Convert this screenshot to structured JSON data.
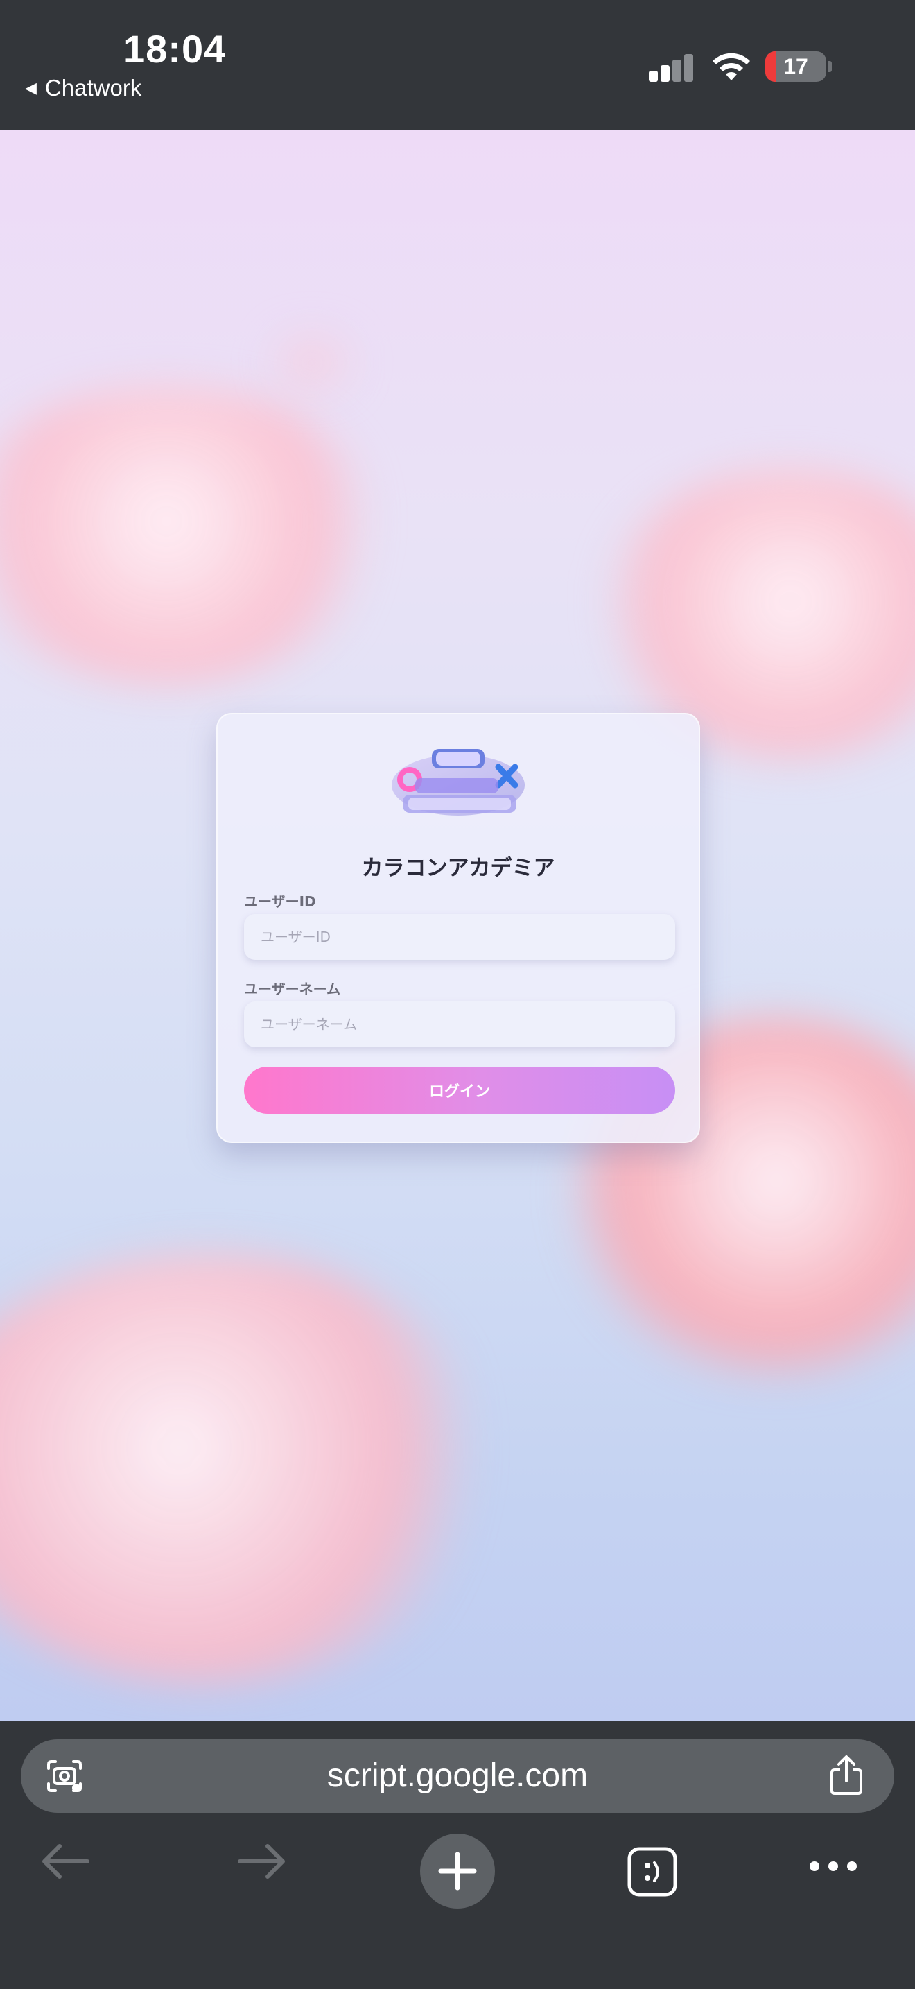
{
  "status_bar": {
    "time": "18:04",
    "back_app_label": "Chatwork",
    "battery_level": "17"
  },
  "login_card": {
    "logo_icon": "quiz-karakon-academia-logo",
    "title": "カラコンアカデミア",
    "user_id": {
      "label": "ユーザーID",
      "value": "",
      "placeholder": "ユーザーID"
    },
    "username": {
      "label": "ユーザーネーム",
      "value": "",
      "placeholder": "ユーザーネーム"
    },
    "login_button": "ログイン"
  },
  "browser": {
    "url": "script.google.com",
    "icons": [
      "visual-lookup-icon",
      "share-icon",
      "back-arrow-icon",
      "forward-arrow-icon",
      "new-tab-plus-icon",
      "tabs-icon",
      "more-icon"
    ]
  },
  "colors": {
    "accent_pink": "#ff77cc",
    "accent_purple": "#c78ff5",
    "chrome_bg": "#33363a"
  }
}
